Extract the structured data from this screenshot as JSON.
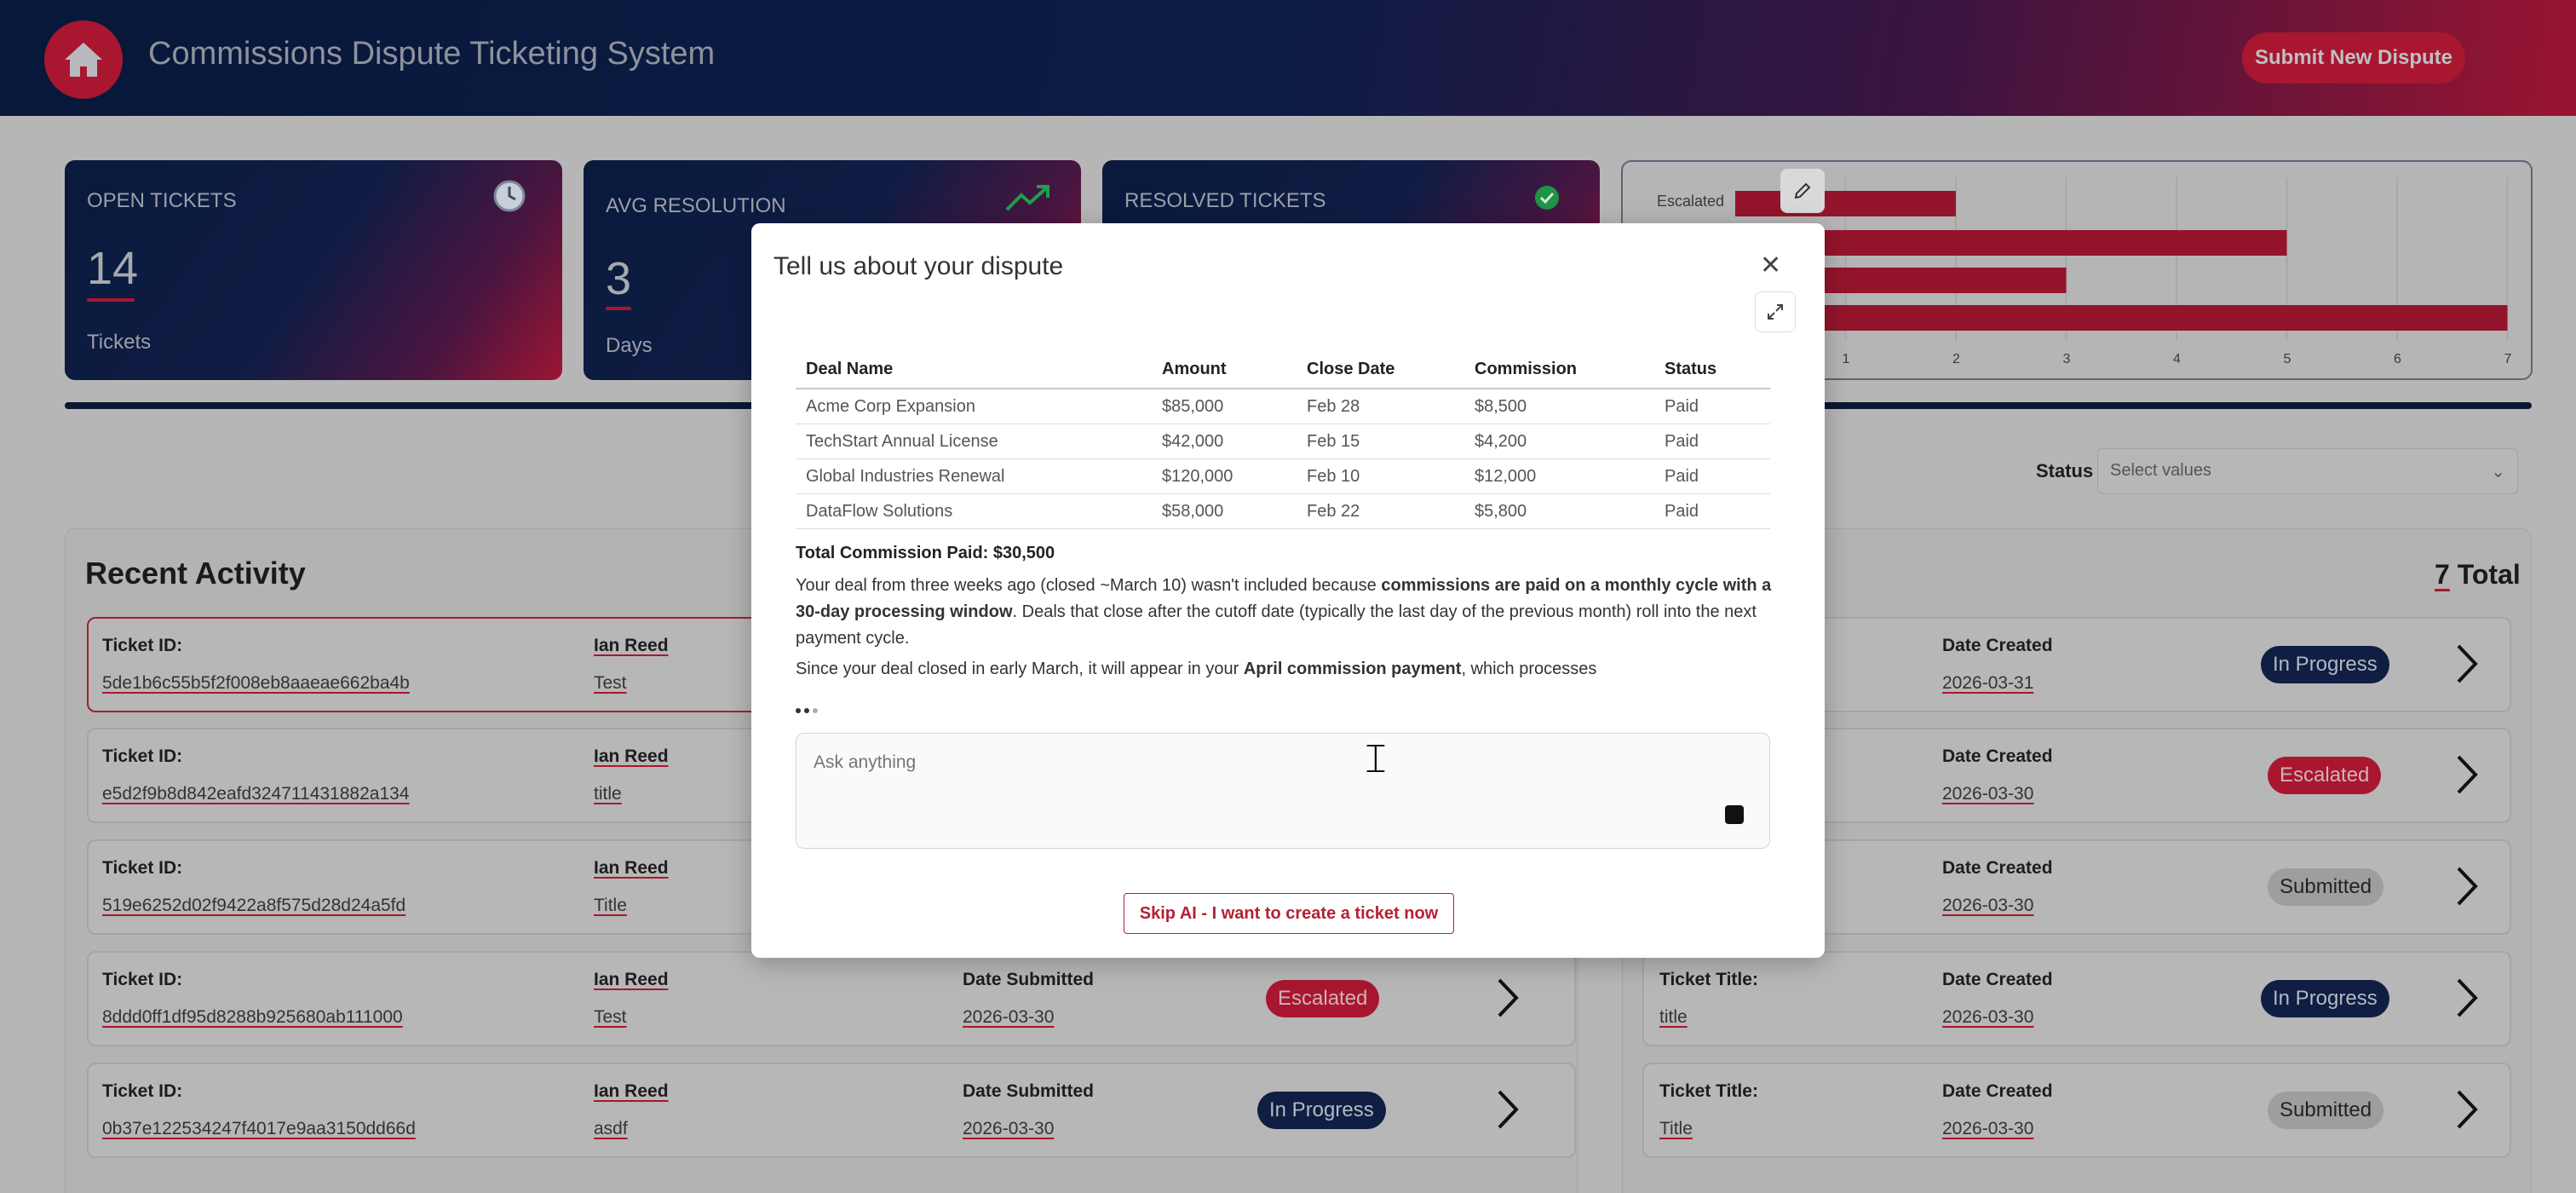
{
  "header": {
    "title": "Commissions Dispute Ticketing System",
    "submit_label": "Submit New Dispute",
    "home_icon": "home-icon"
  },
  "stats": [
    {
      "title": "OPEN TICKETS",
      "value": "14",
      "unit": "Tickets",
      "icon": "clock-icon"
    },
    {
      "title": "AVG RESOLUTION",
      "value": "3",
      "unit": "Days",
      "icon": "trending-up-icon"
    },
    {
      "title": "RESOLVED TICKETS",
      "value": "",
      "unit": "",
      "icon": "check-circle-icon"
    }
  ],
  "chart_data": {
    "type": "bar",
    "orientation": "horizontal",
    "categories": [
      "Escalated",
      "",
      "",
      ""
    ],
    "values": [
      2,
      5,
      3,
      7
    ],
    "xticks": [
      "1",
      "2",
      "3",
      "4",
      "5",
      "6",
      "7"
    ],
    "xlim": [
      0,
      7
    ],
    "grid": true,
    "colors": {
      "bar": "#93142b"
    }
  },
  "filter": {
    "status_label": "Status",
    "status_placeholder": "Select values"
  },
  "recent": {
    "title": "Recent Activity",
    "total_count": "7",
    "total_suffix": " Total"
  },
  "left_rows": [
    {
      "label1": "Ticket ID:",
      "id": "5de1b6c55b5f2f008eb8aaeae662ba4b",
      "user": "Ian Reed",
      "title": "Test",
      "label3": "",
      "date": "",
      "status": "",
      "status_kind": ""
    },
    {
      "label1": "Ticket ID:",
      "id": "e5d2f9b8d842eafd324711431882a134",
      "user": "Ian Reed",
      "title": "title",
      "label3": "",
      "date": "",
      "status": "",
      "status_kind": ""
    },
    {
      "label1": "Ticket ID:",
      "id": "519e6252d02f9422a8f575d28d24a5fd",
      "user": "Ian Reed",
      "title": "Title",
      "label3": "",
      "date": "",
      "status": "",
      "status_kind": ""
    },
    {
      "label1": "Ticket ID:",
      "id": "8ddd0ff1df95d8288b925680ab111000",
      "user": "Ian Reed",
      "title": "Test",
      "label3": "Date Submitted",
      "date": "2026-03-30",
      "status": "Escalated",
      "status_kind": "escalated"
    },
    {
      "label1": "Ticket ID:",
      "id": "0b37e122534247f4017e9aa3150dd66d",
      "user": "Ian Reed",
      "title": "asdf",
      "label3": "Date Submitted",
      "date": "2026-03-30",
      "status": "In Progress",
      "status_kind": "progress"
    }
  ],
  "right_rows": [
    {
      "label1": "",
      "title": "",
      "label2": "Date Created",
      "date": "2026-03-31",
      "status": "In Progress",
      "status_kind": "progress"
    },
    {
      "label1": "",
      "title": "",
      "label2": "Date Created",
      "date": "2026-03-30",
      "status": "Escalated",
      "status_kind": "escalated"
    },
    {
      "label1": "",
      "title": "",
      "label2": "Date Created",
      "date": "2026-03-30",
      "status": "Submitted",
      "status_kind": "submitted"
    },
    {
      "label1": "Ticket Title:",
      "title": "title",
      "label2": "Date Created",
      "date": "2026-03-30",
      "status": "In Progress",
      "status_kind": "progress"
    },
    {
      "label1": "Ticket Title:",
      "title": "Title",
      "label2": "Date Created",
      "date": "2026-03-30",
      "status": "Submitted",
      "status_kind": "submitted"
    }
  ],
  "modal": {
    "title": "Tell us about your dispute",
    "table": {
      "headers": [
        "Deal Name",
        "Amount",
        "Close Date",
        "Commission",
        "Status"
      ],
      "rows": [
        [
          "Acme Corp Expansion",
          "$85,000",
          "Feb 28",
          "$8,500",
          "Paid"
        ],
        [
          "TechStart Annual License",
          "$42,000",
          "Feb 15",
          "$4,200",
          "Paid"
        ],
        [
          "Global Industries Renewal",
          "$120,000",
          "Feb 10",
          "$12,000",
          "Paid"
        ],
        [
          "DataFlow Solutions",
          "$58,000",
          "Feb 22",
          "$5,800",
          "Paid"
        ]
      ]
    },
    "total": "Total Commission Paid: $30,500",
    "para1_a": "Your deal from three weeks ago (closed ~March 10) wasn't included because ",
    "para1_b": "commissions are paid on a monthly cycle with a 30-day processing window",
    "para1_c": ". Deals that close after the cutoff date (typically the last day of the previous month) roll into the next payment cycle.",
    "para2_a": "Since your deal closed in early March, it will appear in your ",
    "para2_b": "April commission payment",
    "para2_c": ", which processes",
    "ask_placeholder": "Ask anything",
    "skip_label": "Skip AI - I want to create a ticket now"
  }
}
